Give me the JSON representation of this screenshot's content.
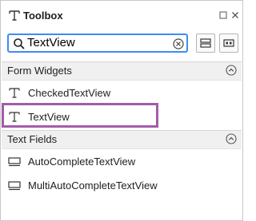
{
  "toolbox": {
    "title": "Toolbox",
    "search": {
      "value": "TextView",
      "placeholder": ""
    },
    "sections": [
      {
        "label": "Form Widgets",
        "items": [
          {
            "label": "CheckedTextView",
            "icon": "text-t-icon"
          },
          {
            "label": "TextView",
            "icon": "text-t-icon",
            "highlighted": true
          }
        ]
      },
      {
        "label": "Text Fields",
        "items": [
          {
            "label": "AutoCompleteTextView",
            "icon": "text-field-icon"
          },
          {
            "label": "MultiAutoCompleteTextView",
            "icon": "text-field-icon"
          }
        ]
      }
    ]
  },
  "colors": {
    "accent": "#3c8df0",
    "highlight": "#a35cab",
    "section_bg": "#f0f0f0"
  }
}
